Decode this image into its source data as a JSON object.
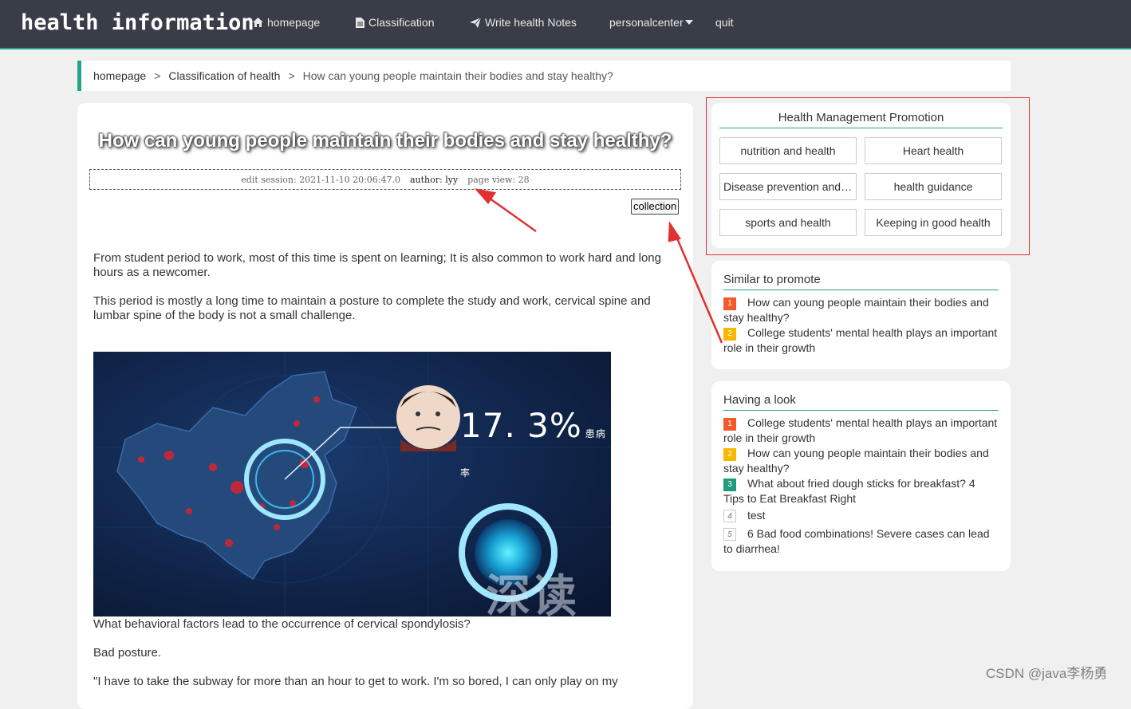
{
  "navbar": {
    "brand": "health information",
    "items": [
      {
        "label": "homepage",
        "icon": "home-icon"
      },
      {
        "label": "Classification",
        "icon": "file-icon"
      },
      {
        "label": "Write health Notes",
        "icon": "send-icon"
      },
      {
        "label": "personalcenter",
        "icon": "caret-down-icon"
      },
      {
        "label": "quit"
      }
    ]
  },
  "breadcrumb": {
    "home": "homepage",
    "separator": ">",
    "category": "Classification of health",
    "current": "How can young people maintain their bodies and stay healthy?"
  },
  "article": {
    "title": "How can young people maintain their bodies and stay healthy?",
    "edit_session": "edit session: 2021-11-10 20:06:47.0",
    "author": "author: lyy",
    "page_view": "page view: 28",
    "collection_label": "collection",
    "paragraphs": [
      "From student period to work, most of this time is spent on learning; It is also common to work hard and long hours as a newcomer.",
      "This period is mostly a long time to maintain a posture to complete the study and work, cervical spine and lumbar spine of the body is not a small challenge.",
      "What behavioral factors lead to the occurrence of cervical spondylosis?",
      "Bad posture.",
      "\"I have to take the subway for more than an hour to get to work. I'm so bored, I can only play on my"
    ],
    "image": {
      "percent": "17. 3%",
      "percent_unit": "患病率",
      "watermark": "深读"
    }
  },
  "promotion": {
    "title": "Health Management Promotion",
    "categories": [
      "nutrition and health",
      "Heart health",
      "Disease prevention and treatment",
      "health guidance",
      "sports and health",
      "Keeping in good health"
    ]
  },
  "similar": {
    "title": "Similar to promote",
    "items": [
      {
        "rank": "1",
        "text": "How can young people maintain their bodies and stay healthy?"
      },
      {
        "rank": "2",
        "text": "College students' mental health plays an important role in their growth"
      }
    ]
  },
  "having_look": {
    "title": "Having a look",
    "items": [
      {
        "rank": "1",
        "text": "College students' mental health plays an important role in their growth"
      },
      {
        "rank": "2",
        "text": "How can young people maintain their bodies and stay healthy?"
      },
      {
        "rank": "3",
        "text": "What about fried dough sticks for breakfast? 4 Tips to Eat Breakfast Right"
      },
      {
        "rank": "4",
        "text": "test"
      },
      {
        "rank": "5",
        "text": "6 Bad food combinations! Severe cases can lead to diarrhea!"
      }
    ]
  },
  "watermark": "CSDN @java李杨勇",
  "colors": {
    "navbar": "#383d47",
    "accent": "#23a589",
    "rank1": "#f25b29",
    "rank2": "#f9b700",
    "rank3": "#1f9c7e",
    "annotation": "#e03030"
  }
}
